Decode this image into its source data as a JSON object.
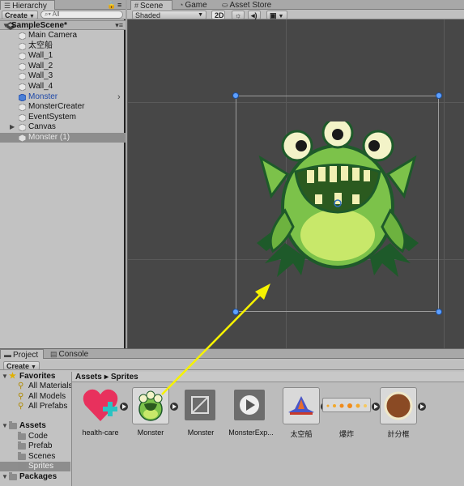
{
  "hierarchy": {
    "tab_label": "Hierarchy",
    "create_label": "Create",
    "search_placeholder": "All",
    "scene_name": "SampleScene*",
    "items": [
      {
        "label": "Main Camera",
        "kind": "object",
        "selected": false
      },
      {
        "label": "太空船",
        "kind": "object",
        "selected": false
      },
      {
        "label": "Wall_1",
        "kind": "object",
        "selected": false
      },
      {
        "label": "Wall_2",
        "kind": "object",
        "selected": false
      },
      {
        "label": "Wall_3",
        "kind": "object",
        "selected": false
      },
      {
        "label": "Wall_4",
        "kind": "object",
        "selected": false
      },
      {
        "label": "Monster",
        "kind": "prefab",
        "selected": false
      },
      {
        "label": "MonsterCreater",
        "kind": "object",
        "selected": false
      },
      {
        "label": "EventSystem",
        "kind": "object",
        "selected": false
      },
      {
        "label": "Canvas",
        "kind": "object",
        "selected": false
      },
      {
        "label": "Monster (1)",
        "kind": "object",
        "selected": true
      }
    ]
  },
  "scene": {
    "tabs": [
      {
        "label": "Scene",
        "icon": "grid-icon"
      },
      {
        "label": "Game",
        "icon": "pacman-icon"
      },
      {
        "label": "Asset Store",
        "icon": "store-icon"
      }
    ],
    "shading_mode": "Shaded",
    "mode_2d": "2D"
  },
  "project": {
    "tabs": [
      {
        "label": "Project",
        "icon": "folder-icon"
      },
      {
        "label": "Console",
        "icon": "console-icon"
      }
    ],
    "create_label": "Create",
    "tree": [
      {
        "label": "Favorites",
        "kind": "header-star"
      },
      {
        "label": "All Materials",
        "kind": "search"
      },
      {
        "label": "All Models",
        "kind": "search"
      },
      {
        "label": "All Prefabs",
        "kind": "search"
      },
      {
        "label": "Assets",
        "kind": "header-folder"
      },
      {
        "label": "Code",
        "kind": "folder"
      },
      {
        "label": "Prefab",
        "kind": "folder"
      },
      {
        "label": "Scenes",
        "kind": "folder"
      },
      {
        "label": "Sprites",
        "kind": "folder",
        "selected": true
      },
      {
        "label": "Packages",
        "kind": "header-folder"
      }
    ],
    "breadcrumb": [
      "Assets",
      "Sprites"
    ],
    "assets": [
      {
        "label": "health-care",
        "icon": "heart-plus-icon"
      },
      {
        "label": "Monster",
        "icon": "monster-sprite-icon"
      },
      {
        "label": "Monster",
        "icon": "prefab-icon"
      },
      {
        "label": "MonsterExp...",
        "icon": "animation-icon"
      },
      {
        "label": "太空船",
        "icon": "spaceship-icon"
      },
      {
        "label": "爆炸",
        "icon": "explosion-strip-icon"
      },
      {
        "label": "計分框",
        "icon": "score-frame-icon"
      }
    ]
  },
  "colors": {
    "monster_green": "#7cc24a",
    "selection_handle": "#5ea0ff",
    "drag_arrow": "#f6f200",
    "prefab_blue": "#1c47a8"
  }
}
